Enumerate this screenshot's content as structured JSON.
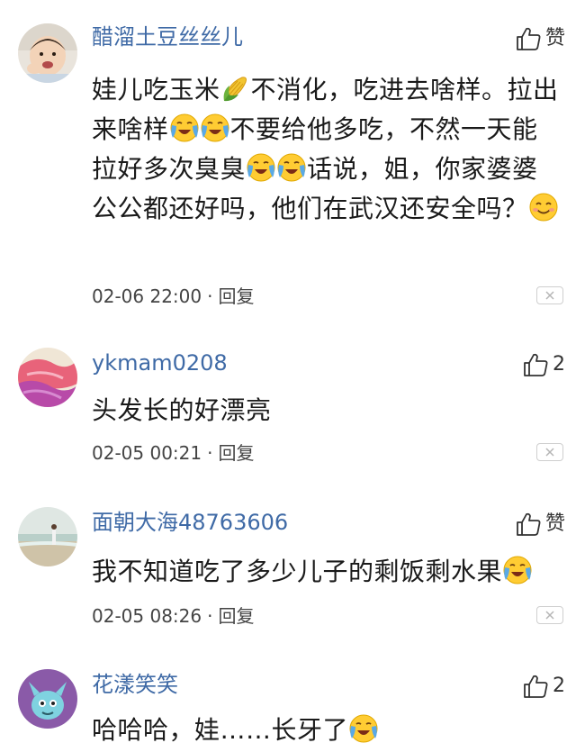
{
  "comments": [
    {
      "username": "醋溜土豆丝丝儿",
      "like_label": "赞",
      "body_parts": [
        "娃儿吃玉米",
        "不消化，吃进去啥样。拉出来啥样",
        "不要给他多吃，不然一天能拉好多次臭臭",
        "话说，姐，你家婆婆公公都还好吗，他们在武汉还安全吗？"
      ],
      "time": "02-06 22:00",
      "reply_label": "回复"
    },
    {
      "username": "ykmam0208",
      "like_label": "2",
      "body_parts": [
        "头发长的好漂亮"
      ],
      "time": "02-05 00:21",
      "reply_label": "回复"
    },
    {
      "username": "面朝大海48763606",
      "like_label": "赞",
      "body_parts": [
        "我不知道吃了多少儿子的剩饭剩水果"
      ],
      "time": "02-05 08:26",
      "reply_label": "回复"
    },
    {
      "username": "花漾笑笑",
      "like_label": "2",
      "body_parts": [
        "哈哈哈，娃……长牙了"
      ]
    }
  ],
  "icons": {
    "like": "thumbs-up-outline",
    "close": "close-x",
    "corn": "corn-emoji",
    "crying": "loudly-crying-emoji",
    "smile": "smiling-emoji"
  },
  "colors": {
    "username": "#3f6aa6",
    "body_text": "#1a1a1a",
    "meta_text": "#444444",
    "emoji_yellow": "#ffcc33",
    "tears": "#5aa9e6"
  }
}
